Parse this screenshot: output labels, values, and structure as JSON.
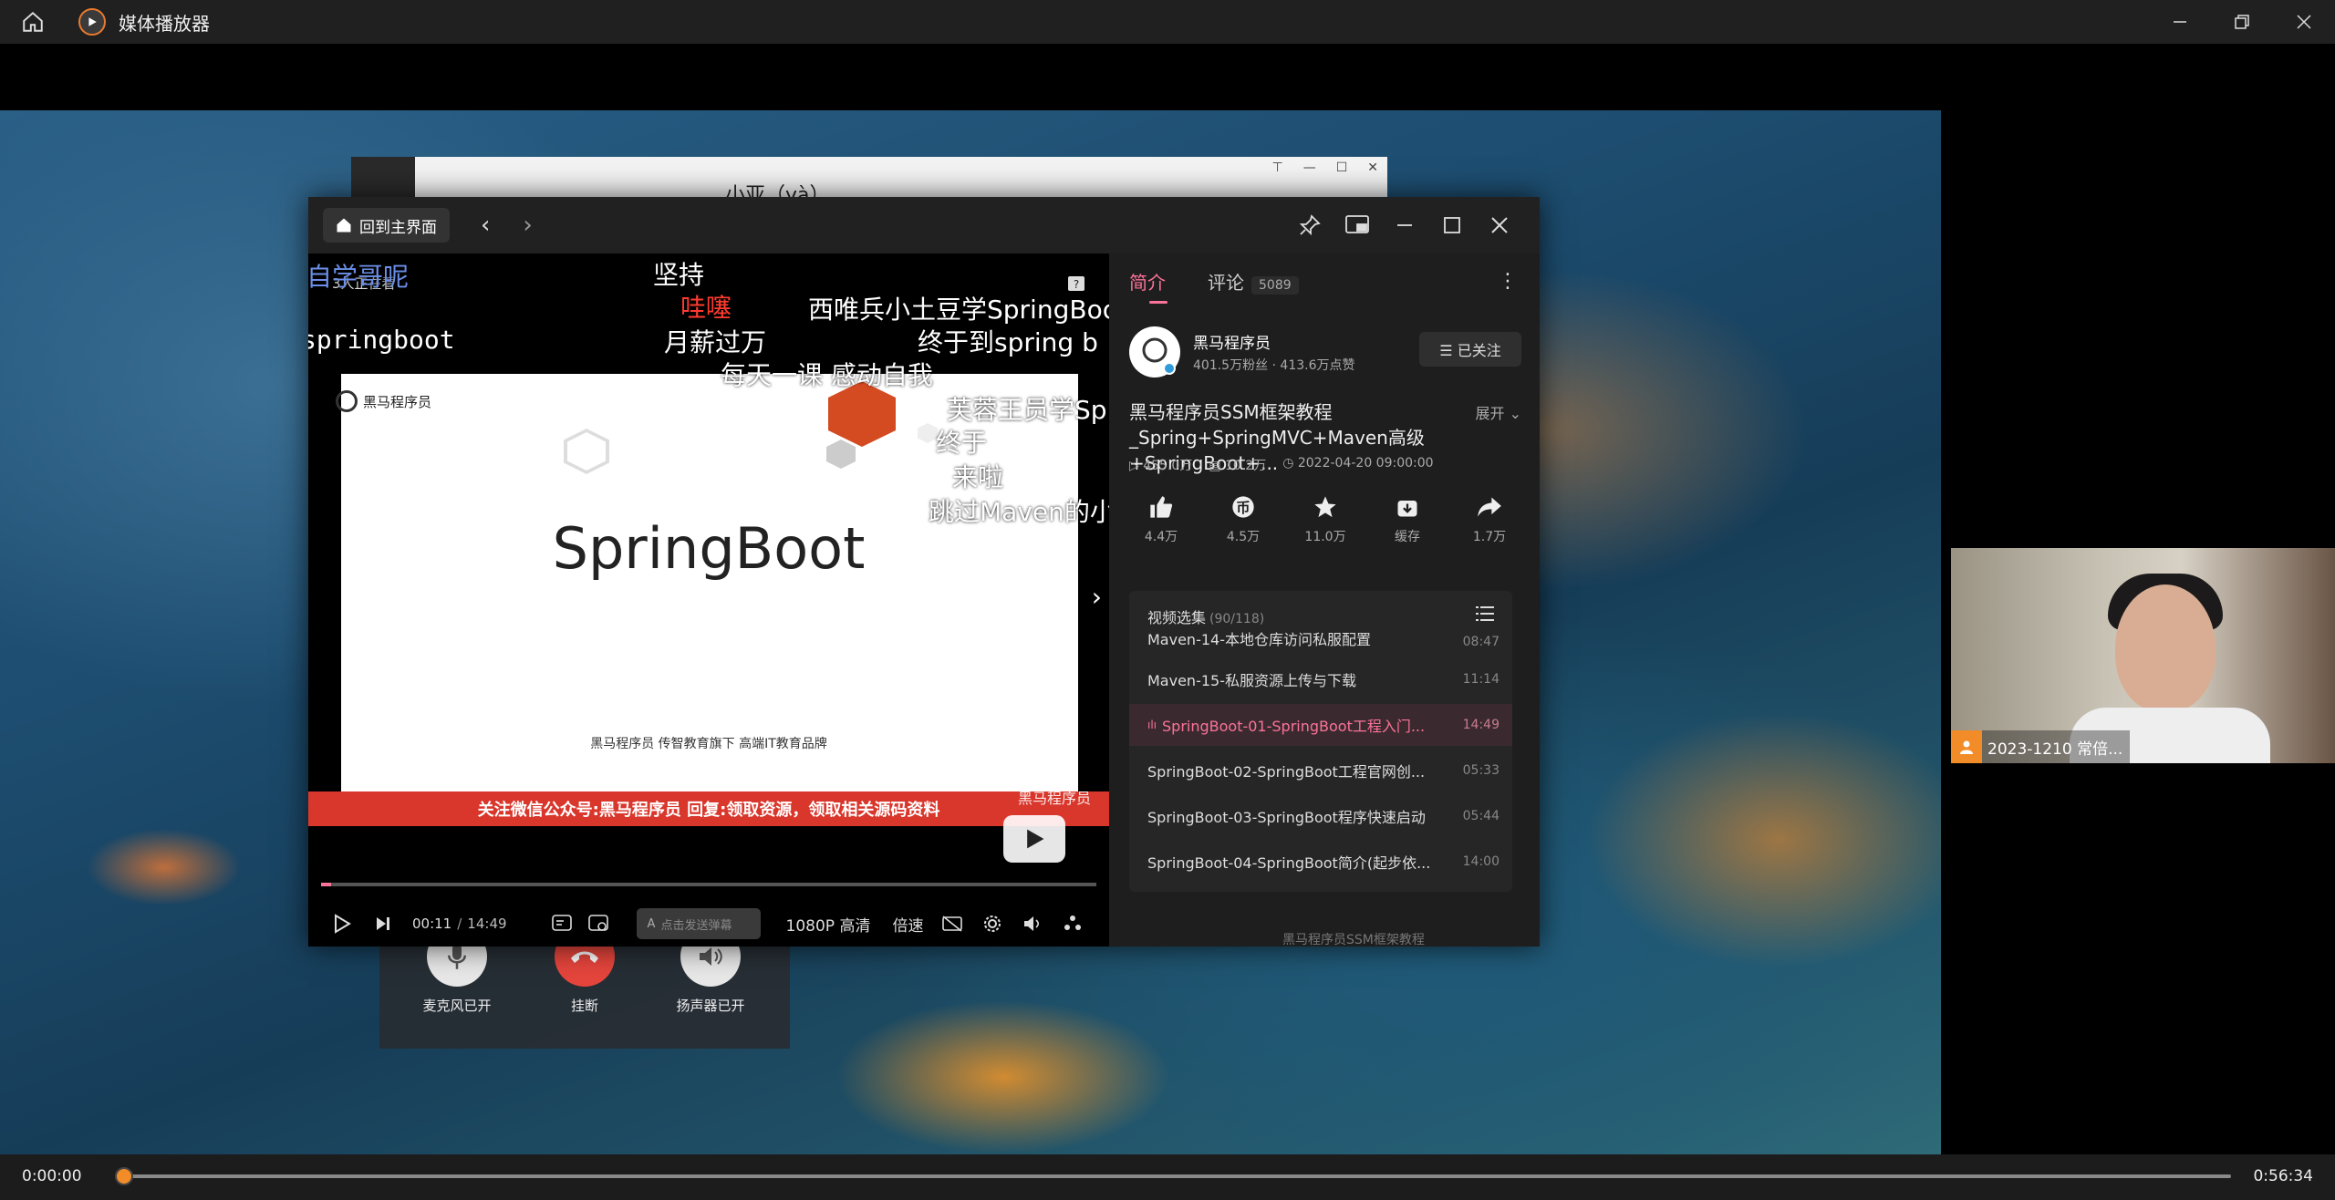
{
  "app": {
    "title": "媒体播放器"
  },
  "camera": {
    "label": "2023-1210 常倍..."
  },
  "call": {
    "mic": "麦克风已开",
    "hangup": "挂断",
    "speaker": "扬声器已开"
  },
  "bg_window": {
    "title": "小亚（yà）"
  },
  "bili": {
    "back_label": "回到主界面",
    "player": {
      "watching": "3人正在看",
      "slide_title": "SpringBoot",
      "slide_logo": "黑马程序员",
      "slide_footer": "黑马程序员 传智教育旗下 高端IT教育品牌",
      "banner": "关注微信公众号:黑马程序员  回复:领取资源，领取相关源码资料",
      "banner_wm": "黑马程序员",
      "time_current": "00:11",
      "time_sep": "/",
      "time_total": "14:49",
      "progress": 0.013,
      "danmaku_placeholder": "点击发送弹幕",
      "quality": "1080P 高清",
      "speed": "倍速"
    },
    "danmaku": [
      {
        "text": "自学哥呢",
        "cls": "blue"
      },
      {
        "text": "坚持",
        "cls": ""
      },
      {
        "text": "哇噻",
        "cls": "red"
      },
      {
        "text": "西唯兵小土豆学SpringBoot",
        "cls": ""
      },
      {
        "text": "springboot",
        "cls": "mono"
      },
      {
        "text": "月薪过万",
        "cls": ""
      },
      {
        "text": "终于到spring b",
        "cls": ""
      },
      {
        "text": "每天一课  感动自我",
        "cls": ""
      },
      {
        "text": "芙蓉王员学Sp",
        "cls": ""
      },
      {
        "text": "终于",
        "cls": ""
      },
      {
        "text": "来啦",
        "cls": ""
      },
      {
        "text": "跳过Maven的小",
        "cls": ""
      }
    ],
    "panel": {
      "tab_intro": "简介",
      "tab_comments": "评论",
      "comment_count": "5089",
      "up_name": "黑马程序员",
      "up_stats": "401.5万粉丝 · 413.6万点赞",
      "follow_label": "☰ 已关注",
      "video_title": "黑马程序员SSM框架教程_Spring+SpringMVC+Maven高级+SpringBoot+...",
      "expand": "展开",
      "views": "455.0万",
      "danmaku_count": "10.2万",
      "date": "2022-04-20 09:00:00",
      "likes": "4.4万",
      "coins": "4.5万",
      "favs": "11.0万",
      "cache": "缓存",
      "shares": "1.7万",
      "playlist_title": "视频选集",
      "playlist_count": "(90/118)",
      "playlist": [
        {
          "name": "Maven-14-本地仓库访问私服配置",
          "dur": "08:47"
        },
        {
          "name": "Maven-15-私服资源上传与下载",
          "dur": "11:14"
        },
        {
          "name": "SpringBoot-01-SpringBoot工程入门...",
          "dur": "14:49"
        },
        {
          "name": "SpringBoot-02-SpringBoot工程官网创...",
          "dur": "05:33"
        },
        {
          "name": "SpringBoot-03-SpringBoot程序快速启动",
          "dur": "05:44"
        },
        {
          "name": "SpringBoot-04-SpringBoot简介(起步依...",
          "dur": "14:00"
        }
      ],
      "footer": "黑马程序员SSM框架教程"
    }
  },
  "bottom": {
    "current": "0:00:00",
    "total": "0:56:34",
    "progress": 0
  }
}
